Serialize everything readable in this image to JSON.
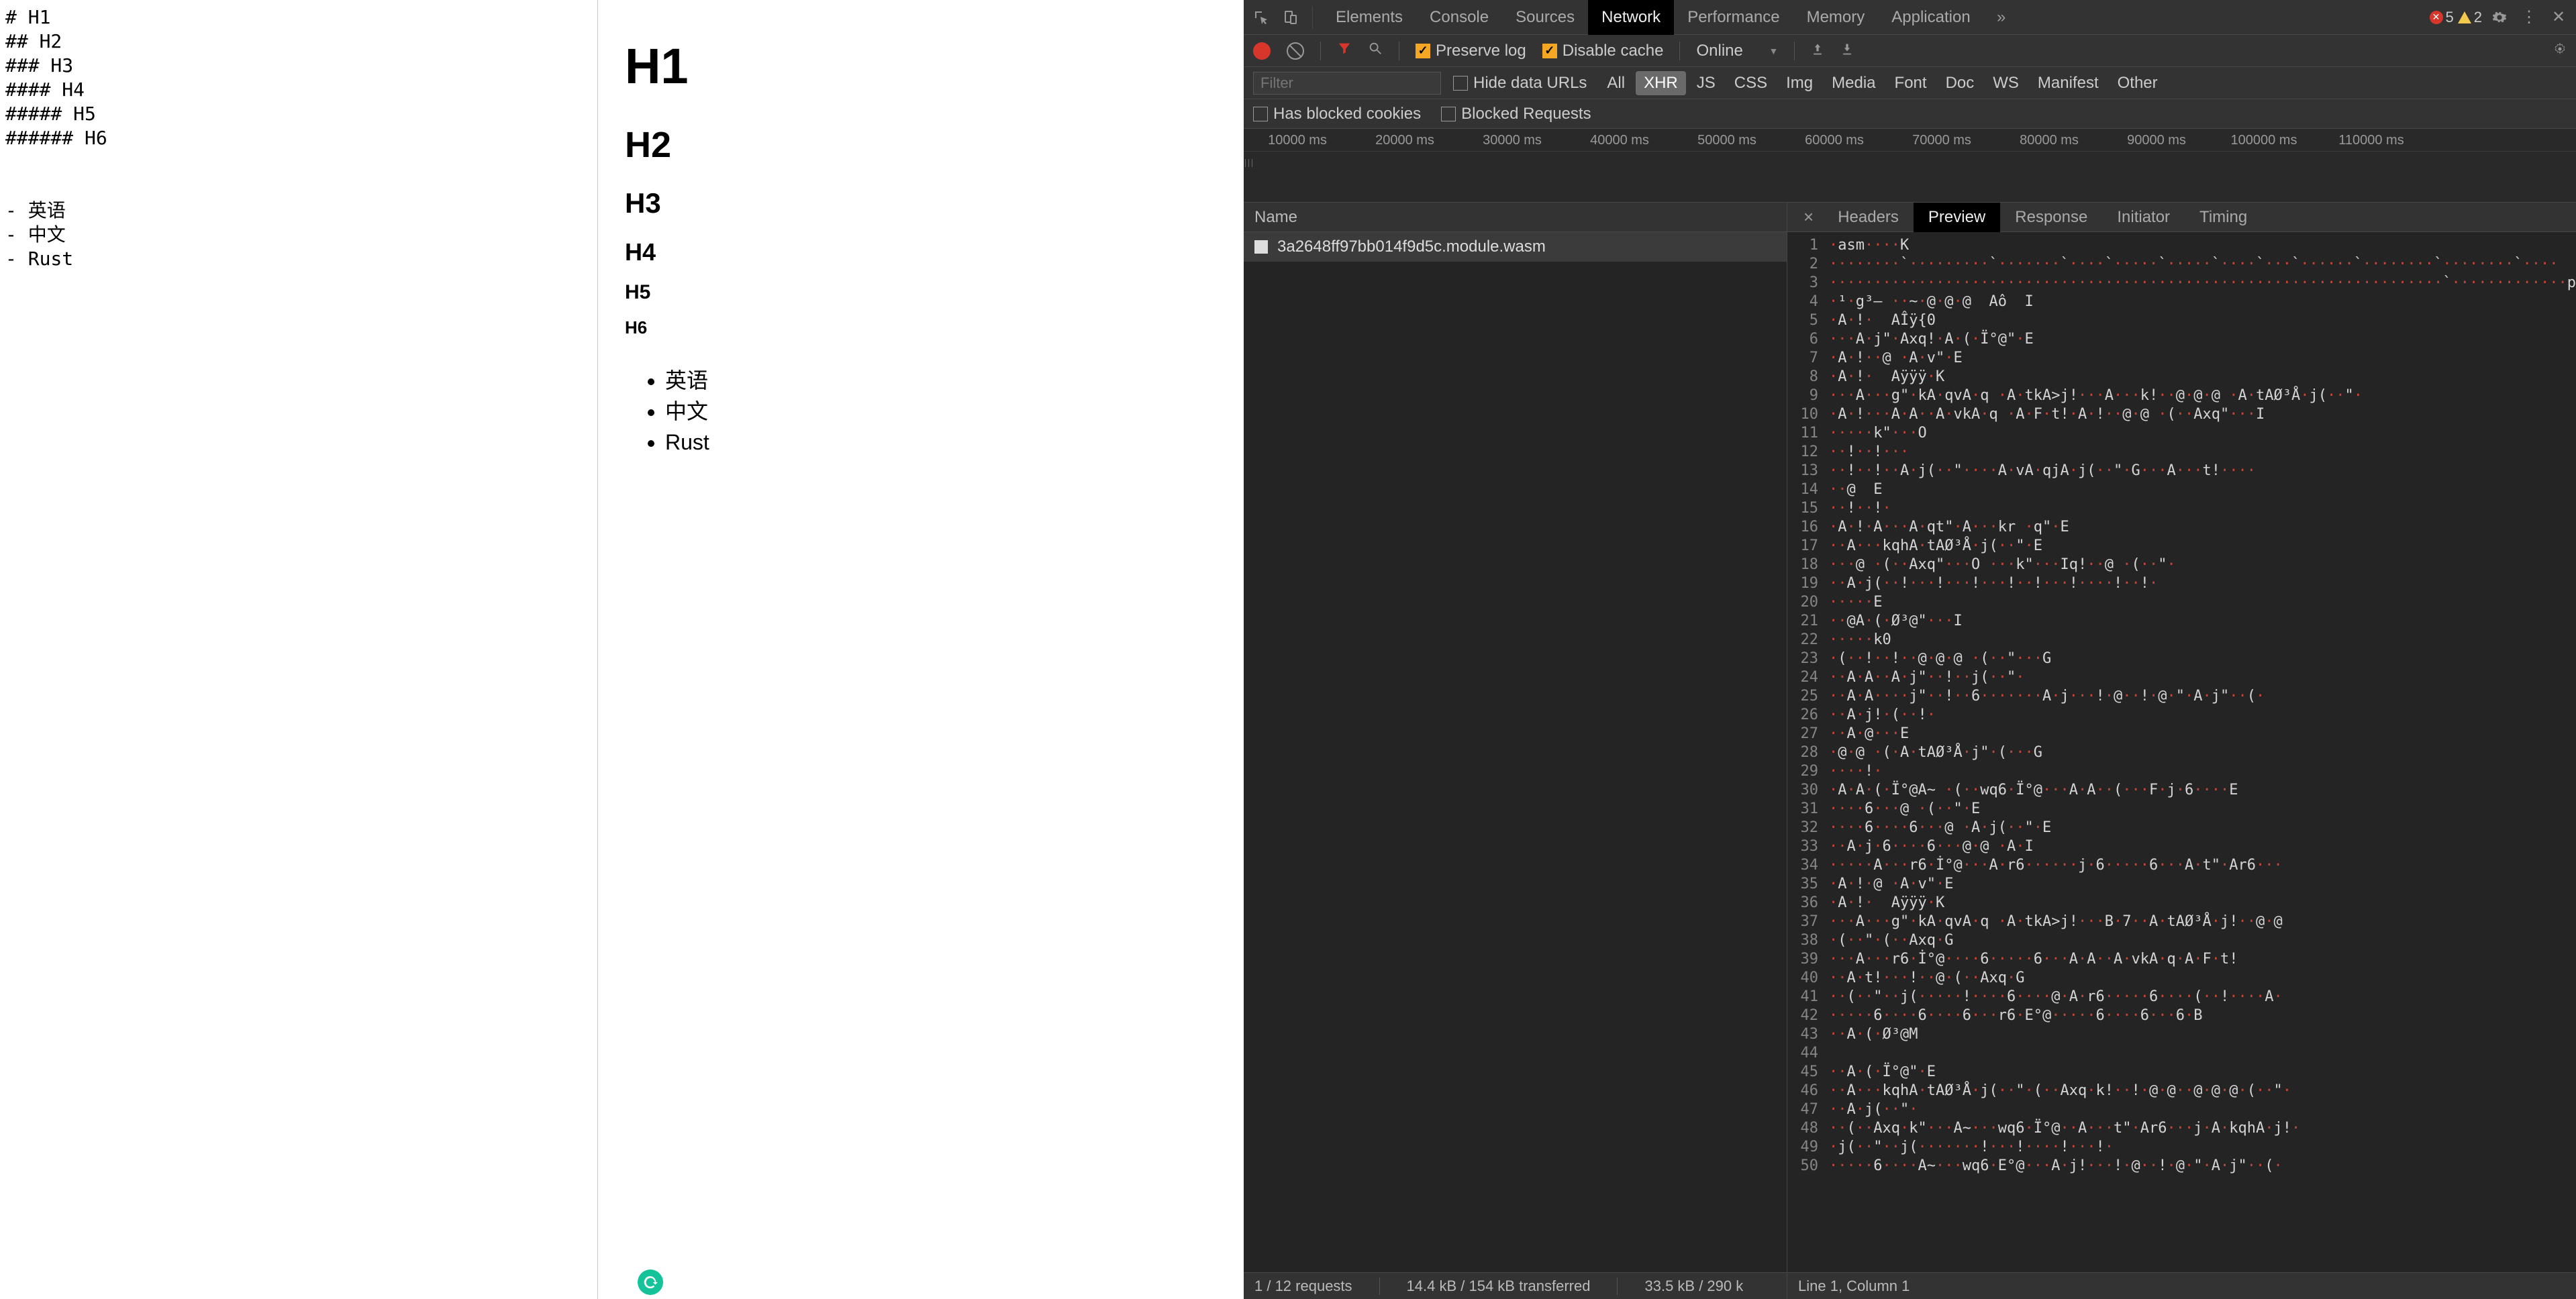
{
  "editor": {
    "lines": [
      "# H1",
      "## H2",
      "### H3",
      "#### H4",
      "##### H5",
      "###### H6",
      "",
      "",
      "- 英语",
      "- 中文",
      "- Rust"
    ]
  },
  "preview": {
    "h1": "H1",
    "h2": "H2",
    "h3": "H3",
    "h4": "H4",
    "h5": "H5",
    "h6": "H6",
    "list": [
      "英语",
      "中文",
      "Rust"
    ]
  },
  "devtools": {
    "tabs": [
      "Elements",
      "Console",
      "Sources",
      "Network",
      "Performance",
      "Memory",
      "Application"
    ],
    "activeTab": "Network",
    "more": "»",
    "errors": "5",
    "warnings": "2",
    "net_toolbar": {
      "preserve_log": "Preserve log",
      "disable_cache": "Disable cache",
      "throttling": "Online",
      "upload_icon": "upload",
      "download_icon": "download"
    },
    "filterbar": {
      "placeholder": "Filter",
      "hide_data_urls": "Hide data URLs",
      "types": [
        "All",
        "XHR",
        "JS",
        "CSS",
        "Img",
        "Media",
        "Font",
        "Doc",
        "WS",
        "Manifest",
        "Other"
      ],
      "active_type": "XHR"
    },
    "filterbar2": {
      "blocked_cookies": "Has blocked cookies",
      "blocked_requests": "Blocked Requests"
    },
    "timeline_ticks": [
      "10000 ms",
      "20000 ms",
      "30000 ms",
      "40000 ms",
      "50000 ms",
      "60000 ms",
      "70000 ms",
      "80000 ms",
      "90000 ms",
      "100000 ms",
      "110000 ms"
    ],
    "req_header": "Name",
    "requests": [
      {
        "name": "3a2648ff97bb014f9d5c.module.wasm"
      }
    ],
    "detail_tabs": [
      "Headers",
      "Preview",
      "Response",
      "Initiator",
      "Timing"
    ],
    "detail_active": "Preview",
    "preview_lines": [
      "·asm····K",
      "········`·········`·······`····`·····`·····`····`···`······`········`········`····",
      "·····································································`·············p",
      "·¹·g³— ··~·@·@·@  Aô  I",
      "·A·!·  AÎÿ{0",
      "···A·j\"·Axq!·A·(·Ï°@\"·E",
      "·A·!··@ ·A·v\"·E",
      "·A·!·  Aÿÿÿ·K",
      "···A···g\"·kA·qvA·q ·A·tkA>j!···A···k!··@·@·@ ·A·tAØ³Å·j(··\"·",
      "·A·!···A·A··A·vkA·q ·A·F·t!·A·!··@·@ ·(··Axq\"···I",
      "·····k\"···O",
      "··!··!···",
      "··!··!··A·j(··\"····A·vA·qjA·j(··\"·G···A···t!····",
      "··@  E",
      "··!··!·",
      "·A·!·A···A·qt\"·A···kr ·q\"·E",
      "··A···kqhA·tAØ³Å·j(··\"·E",
      "···@ ·(··Axq\"···O ···k\"···Iq!··@ ·(··\"·",
      "··A·j(··!···!···!···!··!···!····!··!·",
      "·····E",
      "··@A·(·Ø³@\"···I",
      "·····k0",
      "·(··!··!··@·@·@ ·(··\"···G",
      "··A·A··A·j\"··!··j(··\"·",
      "··A·A····j\"··!··6·······A·j···!·@··!·@·\"·A·j\"··(·",
      "··A·j!·(··!·",
      "··A·@···E",
      "·@·@ ·(·A·tAØ³Å·j\"·(···G",
      "····!·",
      "·A·A·(·Ï°@A~ ·(··wq6·Ï°@···A·A··(···F·j·6····E",
      "····6···@ ·(··\"·E",
      "····6····6···@ ·A·j(··\"·E",
      "··A·j·6····6···@·@ ·A·I",
      "·····A···r6·İ°@···A·r6······j·6·····6···A·t\"·Ar6···",
      "·A·!·@ ·A·v\"·E",
      "·A·!·  Aÿÿÿ·K",
      "···A···g\"·kA·qvA·q ·A·tkA>j!···B·7··A·tAØ³Å·j!··@·@",
      "·(··\"·(··Axq·G",
      "···A···r6·İ°@····6·····6···A·A··A·vkA·q·A·F·t!",
      "··A·t!···!··@·(··Axq·G",
      "··(··\"··j(·····!····6····@·A·r6·····6····(··!····A·",
      "·····6····6····6···r6·E°@·····6····6···6·B",
      "··A·(·Ø³@M",
      "",
      "··A·(·Ï°@\"·E",
      "··A···kqhA·tAØ³Å·j(··\"·(··Axq·k!··!·@·@··@·@·@·(··\"·",
      "··A·j(··\"·",
      "··(··Axq·k\"···A~···wq6·Ï°@··A···t\"·Ar6···j·A·kqhA·j!·",
      "·j(··\"··j(·······!···!····!···!·",
      "·····6····A~···wq6·E°@···A·j!···!·@··!·@·\"·A·j\"··(·"
    ],
    "status": {
      "requests": "1 / 12 requests",
      "transferred": "14.4 kB / 154 kB transferred",
      "resources": "33.5 kB / 290 k"
    },
    "editor_status": "Line 1, Column 1"
  }
}
